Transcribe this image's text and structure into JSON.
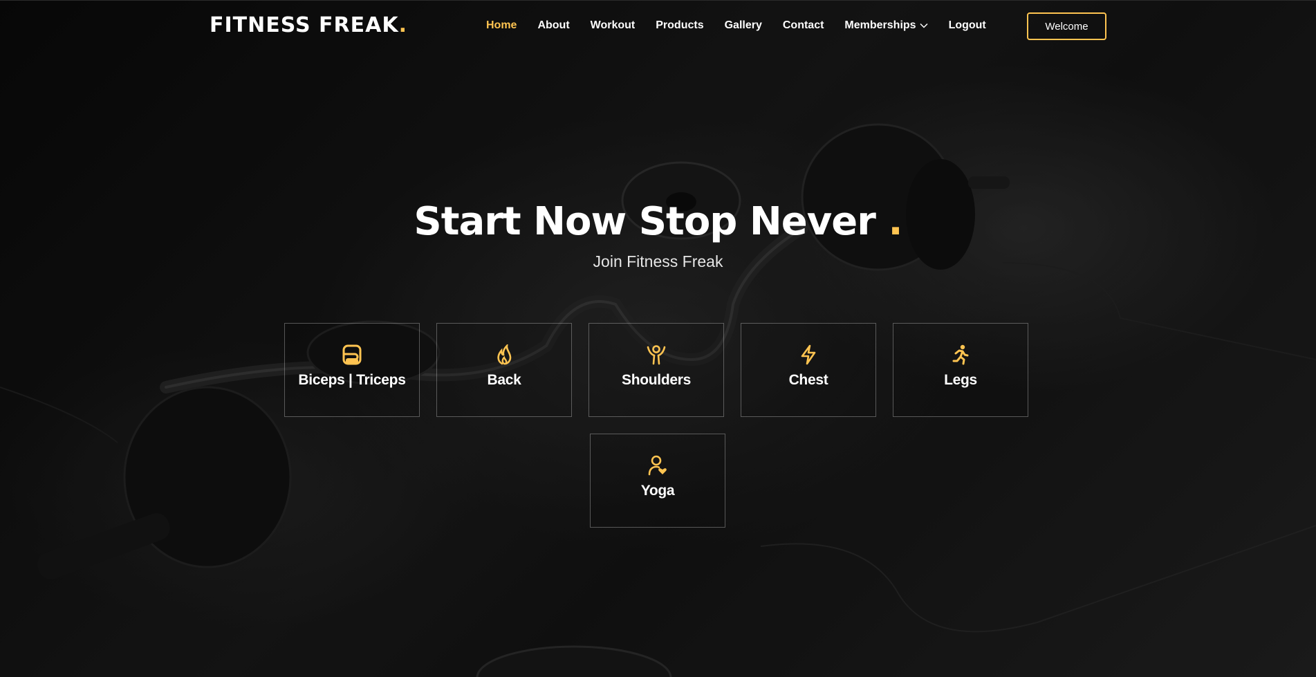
{
  "colors": {
    "accent": "#ffc451",
    "background": "#0b0b0b",
    "text": "#ffffff"
  },
  "header": {
    "logo_text": "FITNESS FREAK",
    "logo_dot": ".",
    "nav": [
      {
        "label": "Home",
        "active": true
      },
      {
        "label": "About"
      },
      {
        "label": "Workout"
      },
      {
        "label": "Products"
      },
      {
        "label": "Gallery"
      },
      {
        "label": "Contact"
      },
      {
        "label": "Memberships",
        "icon": "chevron-down-icon"
      },
      {
        "label": "Logout"
      }
    ],
    "welcome_button": "Welcome"
  },
  "hero": {
    "title": "Start Now Stop Never",
    "title_dot": ".",
    "subtitle": "Join Fitness Freak"
  },
  "categories": [
    {
      "label": "Biceps | Triceps",
      "icon": "dumbbell-box-icon"
    },
    {
      "label": "Back",
      "icon": "fire-icon"
    },
    {
      "label": "Shoulders",
      "icon": "person-arms-up-icon"
    },
    {
      "label": "Chest",
      "icon": "lightning-icon"
    },
    {
      "label": "Legs",
      "icon": "running-person-icon"
    },
    {
      "label": "Yoga",
      "icon": "person-heart-icon"
    }
  ]
}
